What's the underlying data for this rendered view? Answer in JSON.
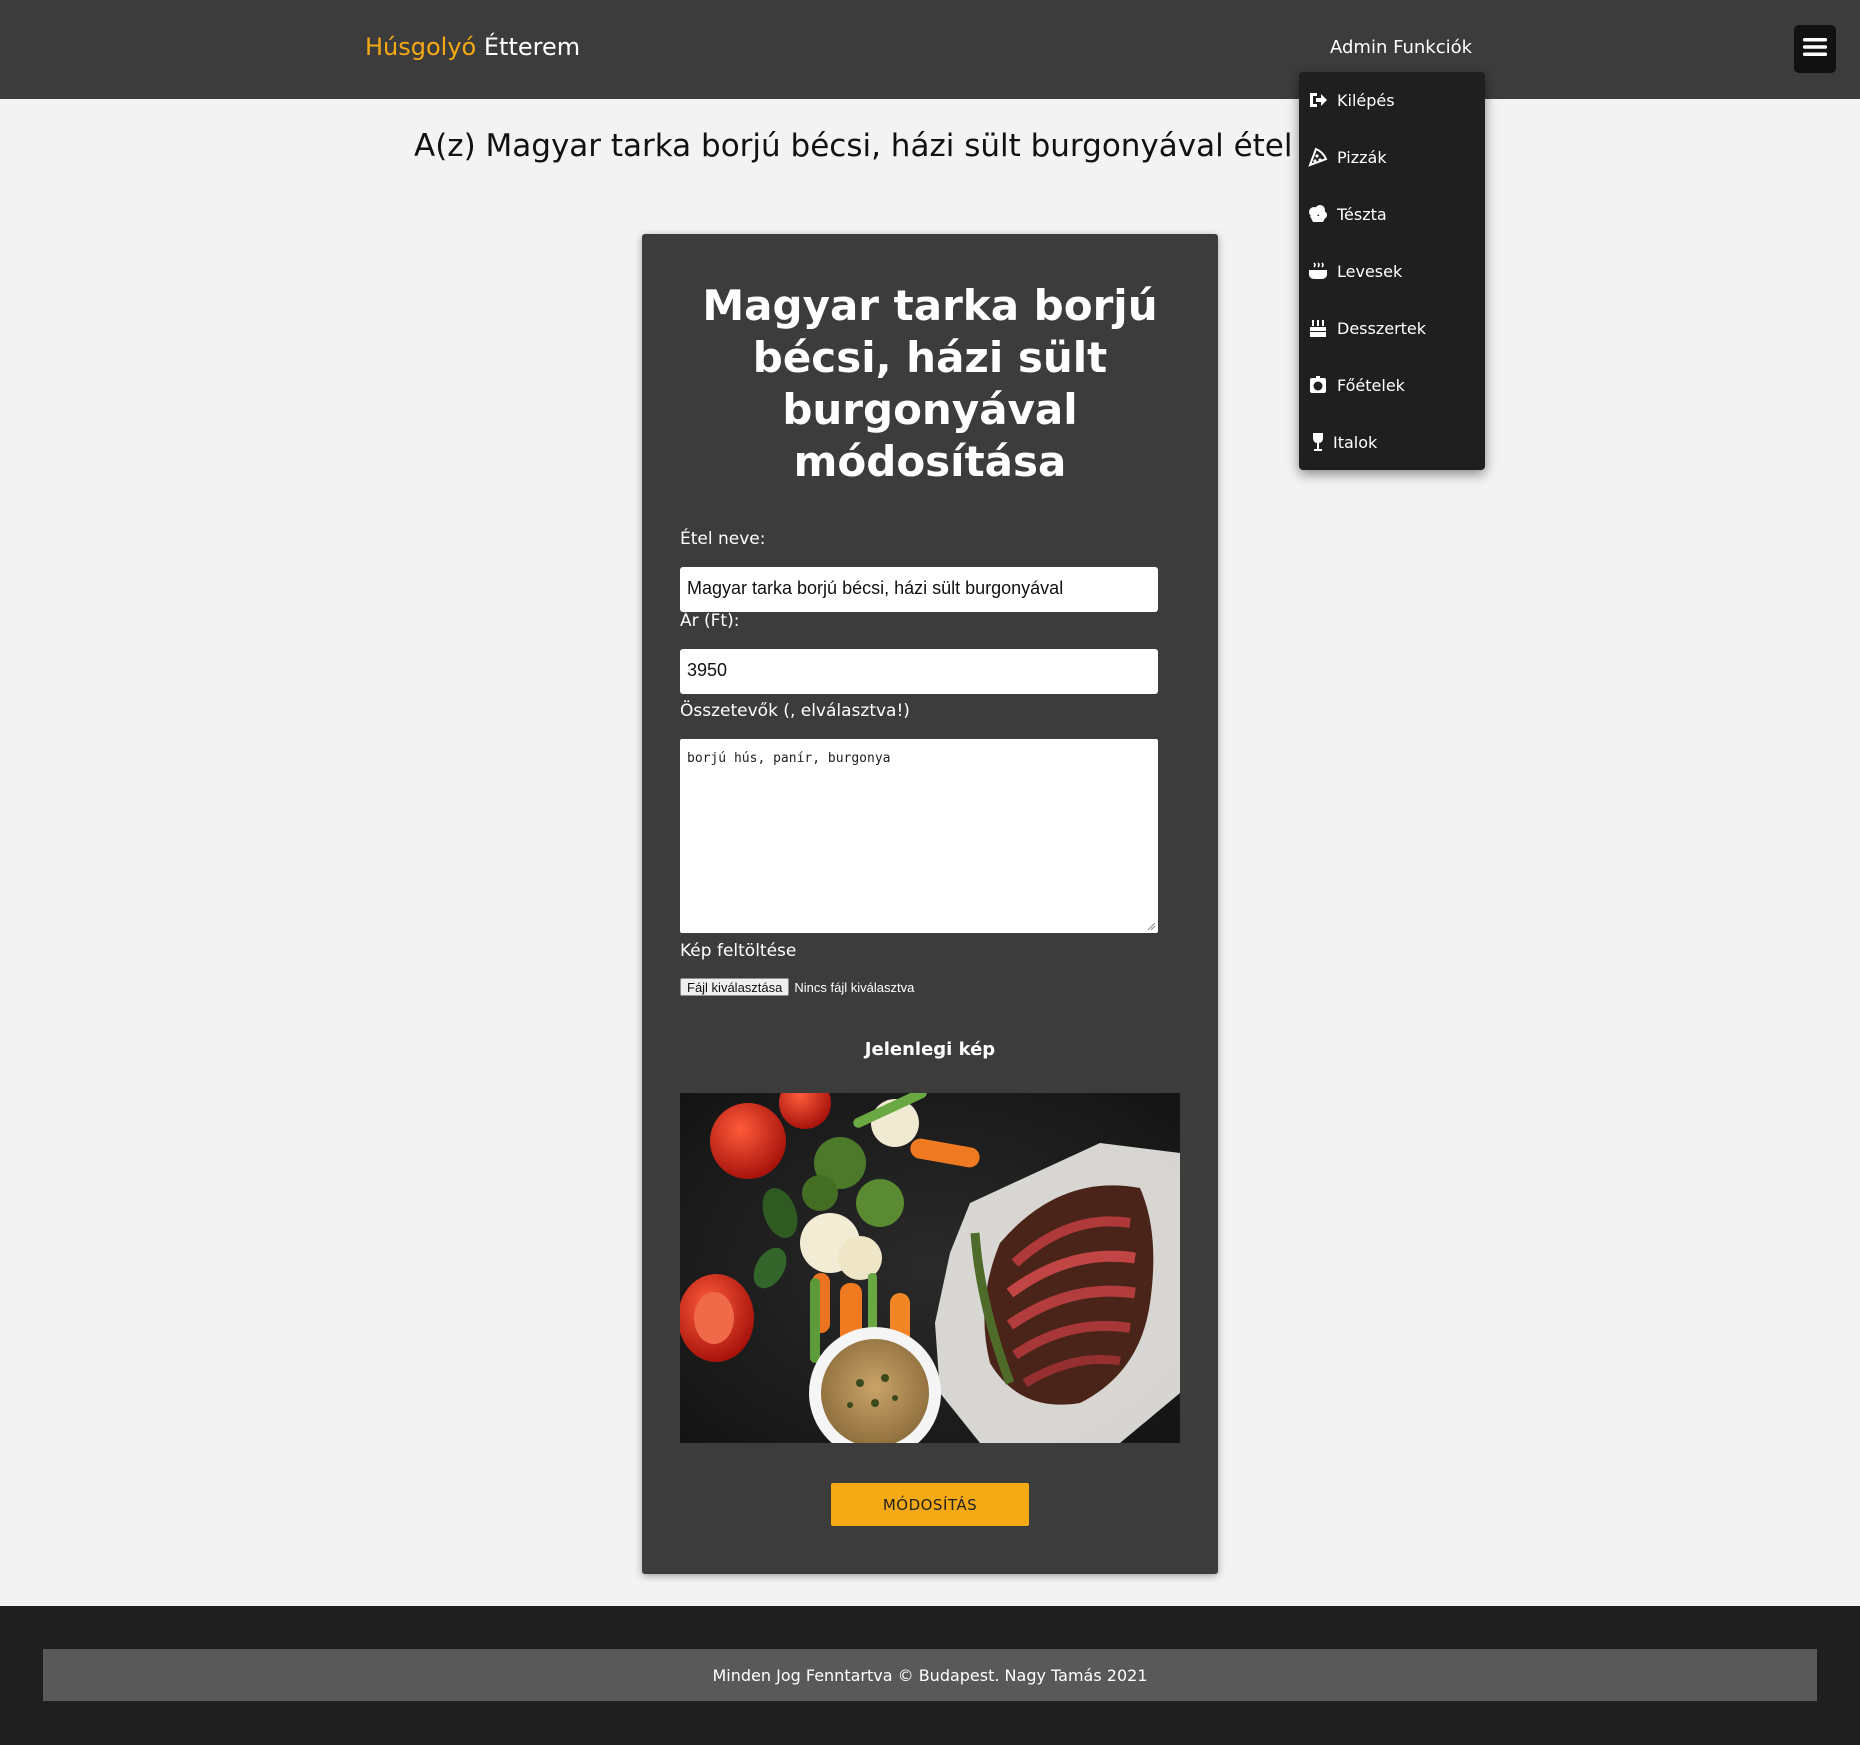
{
  "navbar": {
    "brand_accent": "Húsgolyó",
    "brand_rest": "Étterem",
    "admin_label": "Admin Funkciók",
    "menu_icon": "hamburger-menu-icon"
  },
  "dropdown": {
    "items": [
      {
        "label": "Kilépés",
        "icon": "logout-icon"
      },
      {
        "label": "Pizzák",
        "icon": "pizza-icon"
      },
      {
        "label": "Tészta",
        "icon": "pasta-icon"
      },
      {
        "label": "Levesek",
        "icon": "soup-icon"
      },
      {
        "label": "Desszertek",
        "icon": "cake-icon"
      },
      {
        "label": "Főételek",
        "icon": "main-dish-icon"
      },
      {
        "label": "Italok",
        "icon": "wine-glass-icon"
      }
    ]
  },
  "page": {
    "heading": "A(z) Magyar tarka borjú bécsi, házi sült burgonyával étel m"
  },
  "form": {
    "title": "Magyar tarka borjú bécsi, házi sült burgonyával módosítása",
    "name_label": "Étel neve:",
    "name_value": "Magyar tarka borjú bécsi, házi sült burgonyával",
    "price_label": "Ár (Ft):",
    "price_value": "3950",
    "ingredients_label": "Összetevők (, elválasztva!)",
    "ingredients_value": "borjú hús, panír, burgonya",
    "upload_label": "Kép feltöltése",
    "file_button": "Fájl kiválasztása",
    "file_status": "Nincs fájl kiválasztva",
    "current_image_label": "Jelenlegi kép",
    "submit_label": "MÓDOSÍTÁS"
  },
  "footer": {
    "text": "Minden Jog Fenntartva © Budapest. Nagy Tamás 2021"
  },
  "colors": {
    "accent": "#f5a913",
    "navbar": "#3c3c3c",
    "card": "#3c3c3c",
    "dropdown": "#1f1f1f",
    "footer": "#1f1f1f",
    "page_bg": "#f3f3f3"
  }
}
